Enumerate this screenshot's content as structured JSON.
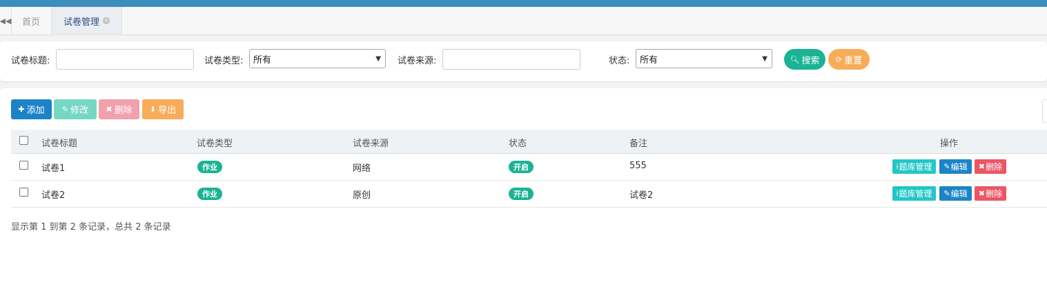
{
  "tabs": {
    "home_label": "首页",
    "active_label": "试卷管理",
    "close_glyph": "×",
    "scroll_left_glyph": "◀◀"
  },
  "search": {
    "title_label": "试卷标题:",
    "title_value": "",
    "type_label": "试卷类型:",
    "type_value": "所有",
    "source_label": "试卷来源:",
    "source_value": "",
    "status_label": "状态:",
    "status_value": "所有",
    "search_button": "搜索",
    "reset_button": "重置"
  },
  "toolbar": {
    "add_label": "添加",
    "edit_label": "修改",
    "delete_label": "删除",
    "export_label": "导出"
  },
  "table": {
    "headers": [
      "试卷标题",
      "试卷类型",
      "试卷来源",
      "状态",
      "备注",
      "操作"
    ],
    "rows": [
      {
        "title": "试卷1",
        "type": "作业",
        "source": "网络",
        "status": "开启",
        "remark": "555"
      },
      {
        "title": "试卷2",
        "type": "作业",
        "source": "原创",
        "status": "开启",
        "remark": "试卷2"
      }
    ],
    "action_labels": {
      "library": "题库管理",
      "edit": "编辑",
      "delete": "删除"
    }
  },
  "footer": {
    "summary": "显示第 1 到第 2 条记录，总共 2 条记录"
  },
  "colors": {
    "topbar": "#3c8dbc",
    "primary": "#1c84c6",
    "success": "#1ab394",
    "warning": "#f8ac59",
    "danger": "#ed5565",
    "info": "#23c6c8"
  }
}
